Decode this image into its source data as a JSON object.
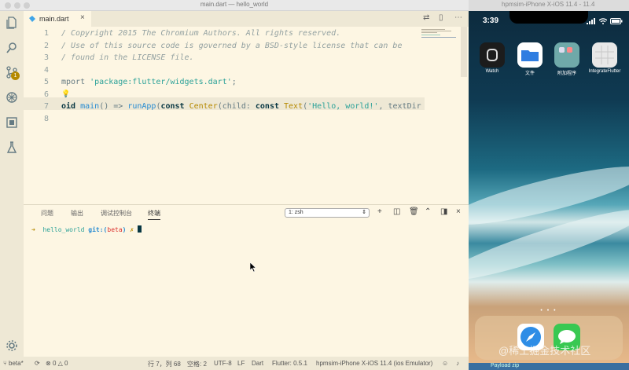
{
  "editor": {
    "window_title": "main.dart — hello_world",
    "tab": {
      "label": "main.dart"
    },
    "code_lines": [
      {
        "n": "1",
        "parts": [
          {
            "c": "cmt",
            "t": "/ Copyright 2015 The Chromium Authors. All rights reserved."
          }
        ]
      },
      {
        "n": "2",
        "parts": [
          {
            "c": "cmt",
            "t": "/ Use of this source code is governed by a BSD-style license that can be"
          }
        ]
      },
      {
        "n": "3",
        "parts": [
          {
            "c": "cmt",
            "t": "/ found in the LICENSE file."
          }
        ]
      },
      {
        "n": "4",
        "parts": []
      },
      {
        "n": "5",
        "parts": [
          {
            "c": "",
            "t": "mport "
          },
          {
            "c": "str",
            "t": "'package:flutter/widgets.dart'"
          },
          {
            "c": "",
            "t": ";"
          }
        ]
      },
      {
        "n": "6",
        "parts": []
      },
      {
        "n": "7",
        "parts": [
          {
            "c": "kw",
            "t": "oid "
          },
          {
            "c": "fn",
            "t": "main"
          },
          {
            "c": "",
            "t": "() => "
          },
          {
            "c": "fn",
            "t": "runApp"
          },
          {
            "c": "",
            "t": "("
          },
          {
            "c": "kw",
            "t": "const "
          },
          {
            "c": "ty",
            "t": "Center"
          },
          {
            "c": "",
            "t": "(child: "
          },
          {
            "c": "kw",
            "t": "const "
          },
          {
            "c": "ty",
            "t": "Text"
          },
          {
            "c": "",
            "t": "("
          },
          {
            "c": "str",
            "t": "'Hello, world!'"
          },
          {
            "c": "",
            "t": ", textDir"
          }
        ]
      },
      {
        "n": "8",
        "parts": []
      }
    ],
    "scm_badge": "1",
    "panel": {
      "tabs": [
        "问题",
        "输出",
        "调试控制台",
        "终端"
      ],
      "active_tab_index": 3,
      "terminal_select": "1: zsh",
      "prompt": {
        "arrow": "➜",
        "dir": "hello_world",
        "git": "git:(",
        "branch": "beta",
        "git_end": ")",
        "mark": "✗"
      }
    },
    "status": {
      "branch": "beta*",
      "errors": "0",
      "warnings": "0",
      "position": "行 7，列 68",
      "spaces": "空格: 2",
      "encoding": "UTF-8",
      "eol": "LF",
      "language": "Dart",
      "flutter": "Flutter: 0.5.1",
      "device": "hpmsim-iPhone X-iOS 11.4 (ios Emulator)"
    }
  },
  "simulator": {
    "window_title": "hpmsim-iPhone X-iOS 11.4 - 11.4",
    "clock": "3:39",
    "apps": [
      {
        "label": "Watch",
        "color": "#1c1c1c"
      },
      {
        "label": "文件",
        "color": "#2f7de1"
      },
      {
        "label": "附加程序",
        "color": "#5f9ea0"
      },
      {
        "label": "IntegrateFlutter",
        "color": "#e8e8e8"
      }
    ],
    "dock_apps": [
      {
        "name": "safari",
        "color": "#2e8de6"
      },
      {
        "name": "messages",
        "color": "#39c852"
      }
    ]
  },
  "watermark": "@稀土掘金技术社区",
  "bottom_strip_text": "Payload  zip"
}
